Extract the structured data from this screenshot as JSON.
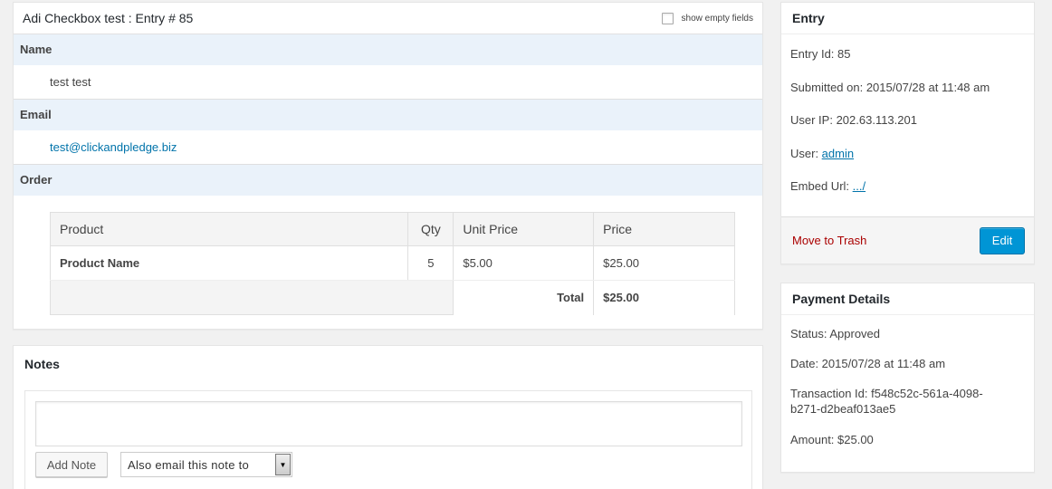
{
  "entry": {
    "title": "Adi Checkbox test : Entry # 85",
    "show_empty_label": "show empty fields",
    "fields": {
      "name_label": "Name",
      "name_value": "test test",
      "email_label": "Email",
      "email_value": "test@clickandpledge.biz",
      "order_label": "Order"
    },
    "order_table": {
      "headers": [
        "Product",
        "Qty",
        "Unit Price",
        "Price"
      ],
      "rows": [
        {
          "product": "Product Name",
          "qty": "5",
          "unit_price": "$5.00",
          "price": "$25.00"
        }
      ],
      "total_label": "Total",
      "total_value": "$25.00"
    }
  },
  "notes": {
    "title": "Notes",
    "textarea_value": "",
    "add_note_label": "Add Note",
    "email_select_value": "Also email this note to"
  },
  "sidebar_entry": {
    "title": "Entry",
    "entry_id": "Entry Id: 85",
    "submitted_on": "Submitted on: 2015/07/28 at 11:48 am",
    "user_ip": "User IP: 202.63.113.201",
    "user_label": "User: ",
    "user_link": "admin",
    "embed_label": "Embed Url: ",
    "embed_link": ".../",
    "trash_label": "Move to Trash",
    "edit_label": "Edit"
  },
  "payment": {
    "title": "Payment Details",
    "status": "Status: Approved",
    "date": "Date: 2015/07/28 at 11:48 am",
    "transaction_line1": "Transaction Id: f548c52c-561a-4098-",
    "transaction_line2": "b271-d2beaf013ae5",
    "amount": "Amount: $25.00"
  },
  "colors": {
    "label_bg": "#eaf2fa",
    "link": "#0073aa",
    "product": "#a0431b",
    "trash": "#aa0000",
    "edit_button": "#0095d5"
  }
}
